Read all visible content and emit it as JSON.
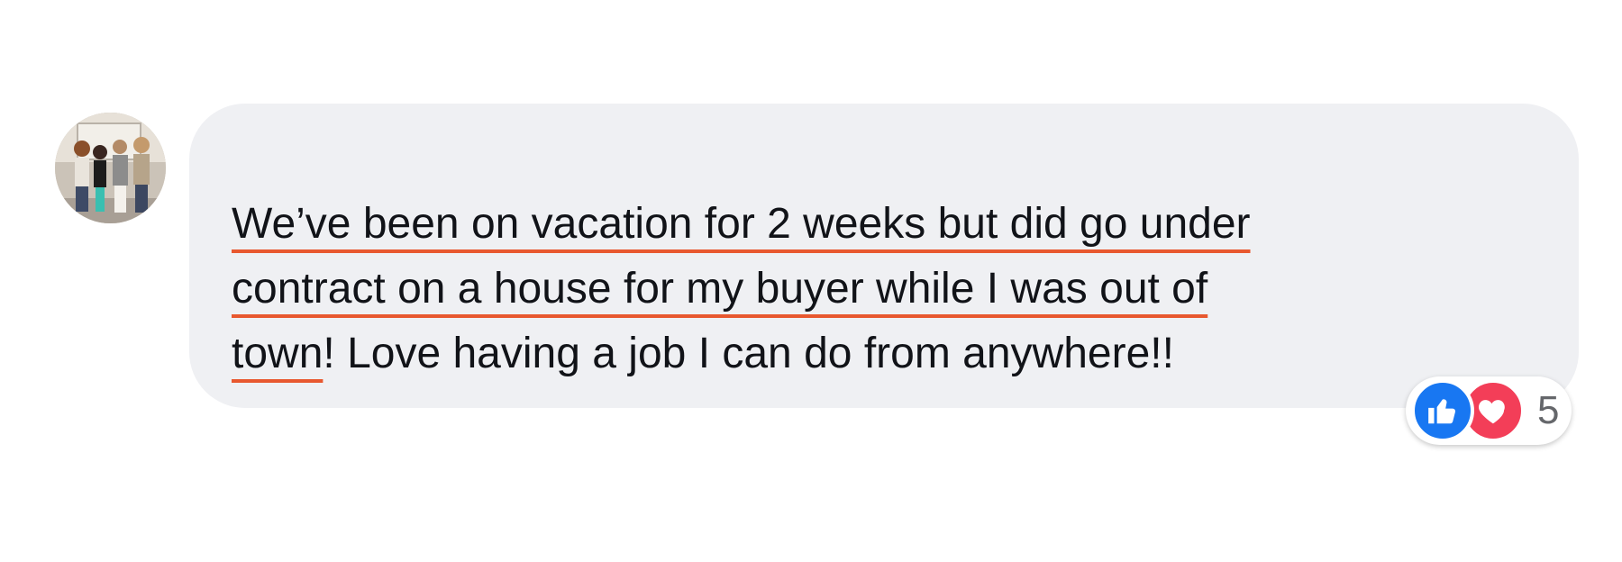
{
  "comment": {
    "lines": [
      {
        "underlined": "We’ve been on vacation for 2 weeks but did go under",
        "rest": ""
      },
      {
        "underlined": "contract on a house for my buyer while I was out of",
        "rest": ""
      },
      {
        "underlined": "town",
        "rest": "! Love having a job I can do from anywhere!!"
      }
    ]
  },
  "reactions": {
    "icons": [
      "like-icon",
      "love-icon"
    ],
    "count": "5"
  },
  "colors": {
    "bubble": "#eff0f3",
    "underline": "#e8582f",
    "like": "#1877f2",
    "love": "#f33e58"
  }
}
